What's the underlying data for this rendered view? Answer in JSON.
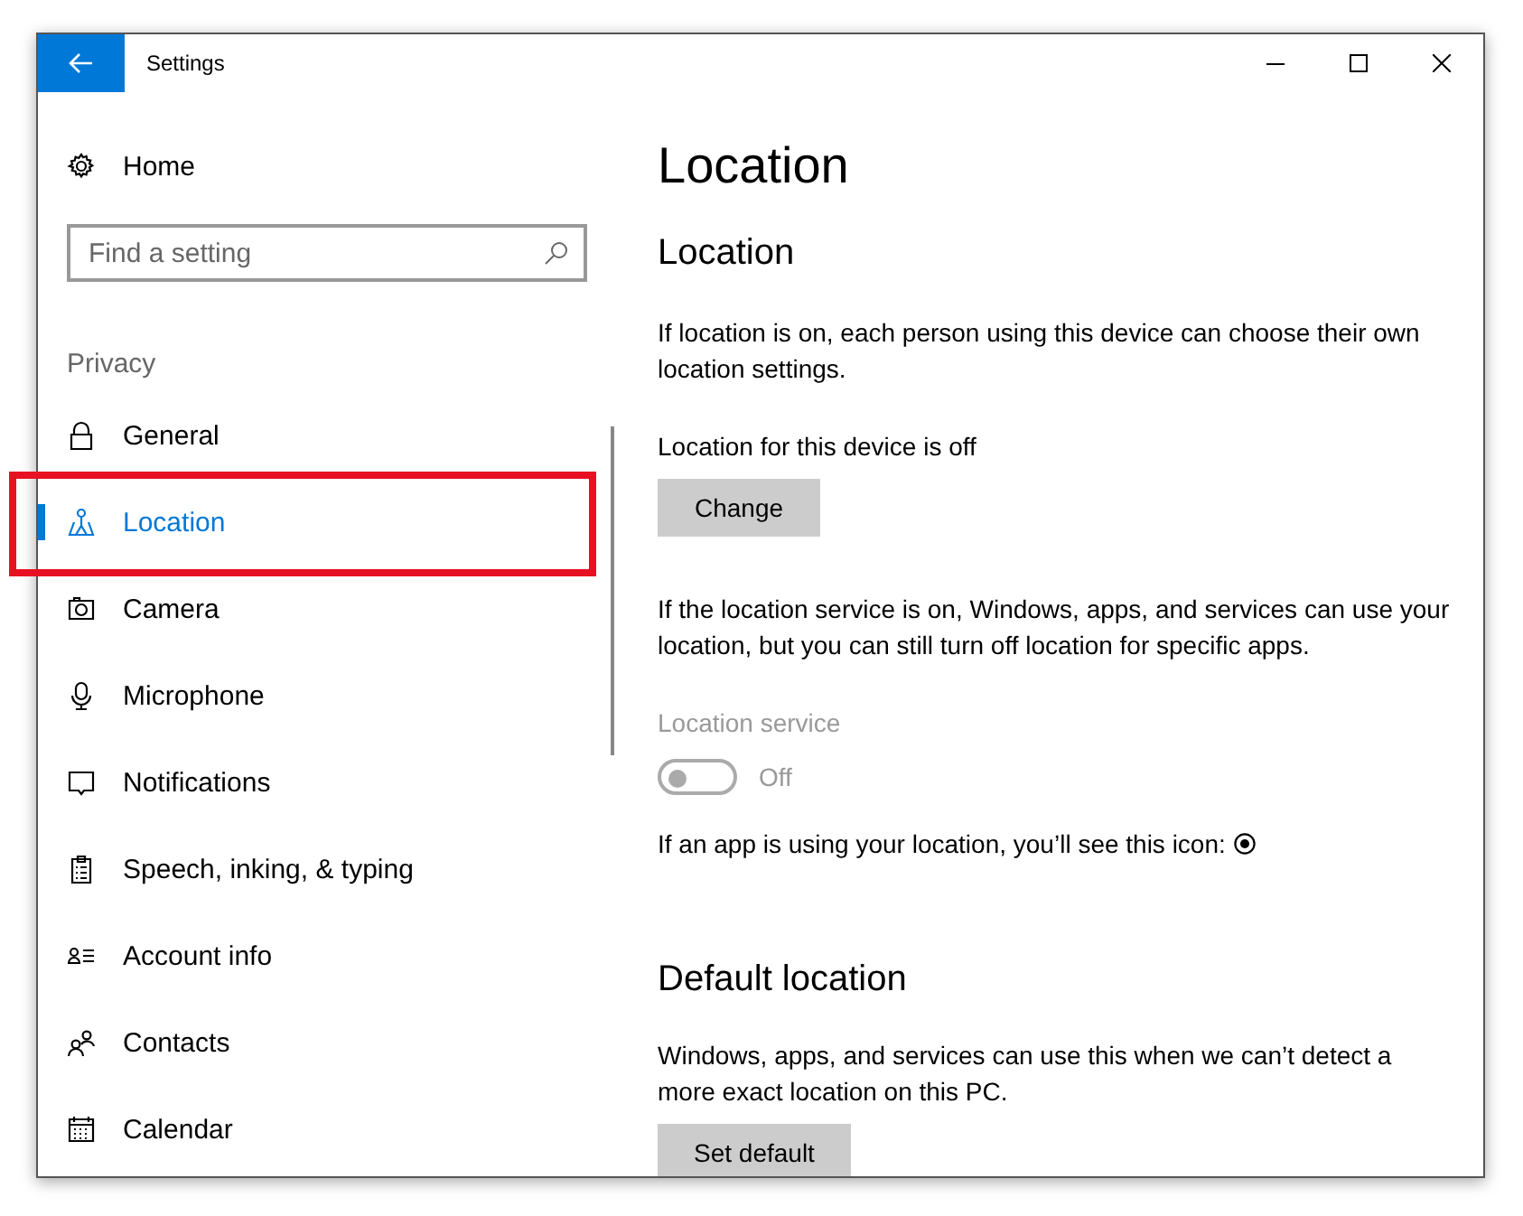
{
  "window": {
    "title": "Settings"
  },
  "sidebar": {
    "home": "Home",
    "search": {
      "placeholder": "Find a setting"
    },
    "section": "Privacy",
    "items": [
      {
        "label": "General",
        "selected": false,
        "highlighted": false
      },
      {
        "label": "Location",
        "selected": true,
        "highlighted": true
      },
      {
        "label": "Camera",
        "selected": false,
        "highlighted": false
      },
      {
        "label": "Microphone",
        "selected": false,
        "highlighted": false
      },
      {
        "label": "Notifications",
        "selected": false,
        "highlighted": false
      },
      {
        "label": "Speech, inking, & typing",
        "selected": false,
        "highlighted": false
      },
      {
        "label": "Account info",
        "selected": false,
        "highlighted": false
      },
      {
        "label": "Contacts",
        "selected": false,
        "highlighted": false
      },
      {
        "label": "Calendar",
        "selected": false,
        "highlighted": false
      }
    ]
  },
  "content": {
    "title": "Location",
    "sections": [
      {
        "heading": "Location",
        "description": "If location is on, each person using this device can choose their own location settings.",
        "status": "Location for this device is off",
        "button": "Change",
        "description_2": "If the location service is on, Windows, apps, and services can use your location, but you can still turn off location for specific apps.",
        "toggle": {
          "label": "Location service",
          "on": false,
          "disabled": true,
          "state_text": "Off"
        },
        "note": "If an app is using your location, you’ll see this icon:"
      },
      {
        "heading": "Default location",
        "description": "Windows, apps, and services can use this when we can’t detect a more exact location on this PC.",
        "button": "Set default"
      }
    ]
  }
}
